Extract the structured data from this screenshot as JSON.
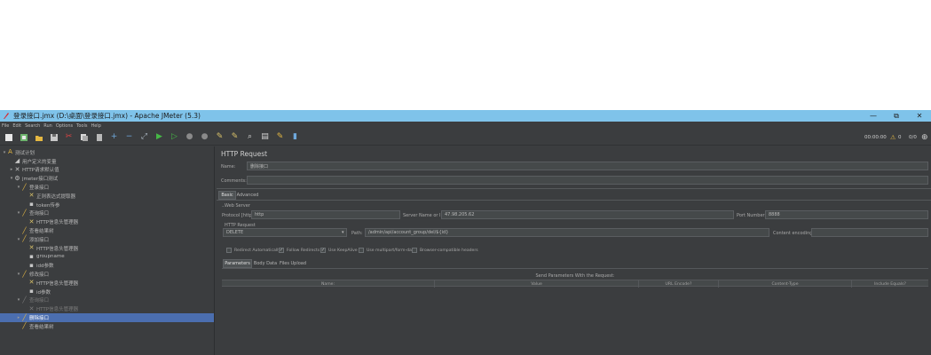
{
  "window": {
    "title": "登录接口.jmx (D:\\桌面\\登录接口.jmx) - Apache JMeter (5.3)",
    "controls": {
      "minimize": "—",
      "maximize": "⧉",
      "close": "✕"
    }
  },
  "menu": [
    "File",
    "Edit",
    "Search",
    "Run",
    "Options",
    "Tools",
    "Help"
  ],
  "toolbar": {
    "icons": [
      "new-icon",
      "templates-icon",
      "open-icon",
      "save-icon",
      "cut-icon",
      "copy-icon",
      "paste-icon",
      "expand-icon",
      "collapse-icon",
      "toggle-icon",
      "start-icon",
      "start-no-pause-icon",
      "stop-icon",
      "shutdown-icon",
      "clear-icon",
      "clear-all-icon",
      "search-icon",
      "reset-search-icon",
      "function-helper-icon",
      "help-icon"
    ],
    "timer": "00:00:00",
    "warnings": "0",
    "threads": "0/0"
  },
  "tree": {
    "nodes": [
      {
        "label": "测试计划",
        "level": 0,
        "icon": "test-plan-icon",
        "state": "expanded"
      },
      {
        "label": "用户定义的变量",
        "level": 1,
        "icon": "variables-icon",
        "state": "leaf"
      },
      {
        "label": "HTTP请求默认值",
        "level": 1,
        "icon": "config-icon",
        "state": "collapsed"
      },
      {
        "label": "jmeter接口测试",
        "level": 1,
        "icon": "thread-group-icon",
        "state": "expanded"
      },
      {
        "label": "登录接口",
        "level": 2,
        "icon": "sampler-icon",
        "state": "expanded"
      },
      {
        "label": "正则表达式提取器",
        "level": 3,
        "icon": "extractor-icon",
        "state": "leaf"
      },
      {
        "label": "token传参",
        "level": 3,
        "icon": "debug-icon",
        "state": "leaf"
      },
      {
        "label": "查询接口",
        "level": 2,
        "icon": "sampler-icon",
        "state": "expanded"
      },
      {
        "label": "HTTP信息头管理器",
        "level": 3,
        "icon": "extractor-icon",
        "state": "leaf"
      },
      {
        "label": "查看结果树",
        "level": 2,
        "icon": "listener-icon",
        "state": "leaf"
      },
      {
        "label": "添加接口",
        "level": 2,
        "icon": "sampler-icon",
        "state": "expanded"
      },
      {
        "label": "HTTP信息头管理器",
        "level": 3,
        "icon": "extractor-icon",
        "state": "leaf"
      },
      {
        "label": "groupname",
        "level": 3,
        "icon": "debug-icon",
        "state": "leaf"
      },
      {
        "label": "idd参数",
        "level": 3,
        "icon": "debug-icon",
        "state": "leaf"
      },
      {
        "label": "修改接口",
        "level": 2,
        "icon": "sampler-icon",
        "state": "expanded"
      },
      {
        "label": "HTTP信息头管理器",
        "level": 3,
        "icon": "extractor-icon",
        "state": "leaf"
      },
      {
        "label": "id参数",
        "level": 3,
        "icon": "debug-icon",
        "state": "leaf"
      },
      {
        "label": "查询接口",
        "level": 2,
        "icon": "sampler-icon",
        "state": "expanded",
        "disabled": true
      },
      {
        "label": "HTTP信息头管理器",
        "level": 3,
        "icon": "extractor-icon",
        "state": "leaf",
        "disabled": true
      },
      {
        "label": "删除接口",
        "level": 2,
        "icon": "sampler-icon",
        "state": "collapsed",
        "selected": true
      },
      {
        "label": "查看结果树",
        "level": 2,
        "icon": "listener-icon",
        "state": "leaf"
      }
    ]
  },
  "panel": {
    "title": "HTTP Request",
    "name_label": "Name:",
    "name_value": "删除接口",
    "comments_label": "Comments:",
    "comments_value": "",
    "tabs": {
      "basic": "Basic",
      "advanced": "Advanced"
    },
    "web_server_legend": "Web Server",
    "protocol_label": "Protocol [http]:",
    "protocol_value": "http",
    "server_label": "Server Name or IP:",
    "server_value": "47.98.205.62",
    "port_label": "Port Number:",
    "port_value": "8888",
    "http_request_legend": "HTTP Request",
    "method_value": "DELETE",
    "path_label": "Path:",
    "path_value": "/admin/api/account_group/del/${id}",
    "encoding_label": "Content encoding:",
    "encoding_value": "",
    "options": [
      {
        "label": "Redirect Automatically",
        "checked": false
      },
      {
        "label": "Follow Redirects",
        "checked": true
      },
      {
        "label": "Use KeepAlive",
        "checked": true
      },
      {
        "label": "Use multipart/form-data",
        "checked": false
      },
      {
        "label": "Browser-compatible headers",
        "checked": false
      }
    ],
    "subtabs": {
      "parameters": "Parameters",
      "body": "Body Data",
      "files": "Files Upload"
    },
    "send_params_title": "Send Parameters With the Request:",
    "columns": [
      "Name:",
      "Value",
      "URL Encode?",
      "Content-Type",
      "Include Equals?"
    ]
  }
}
